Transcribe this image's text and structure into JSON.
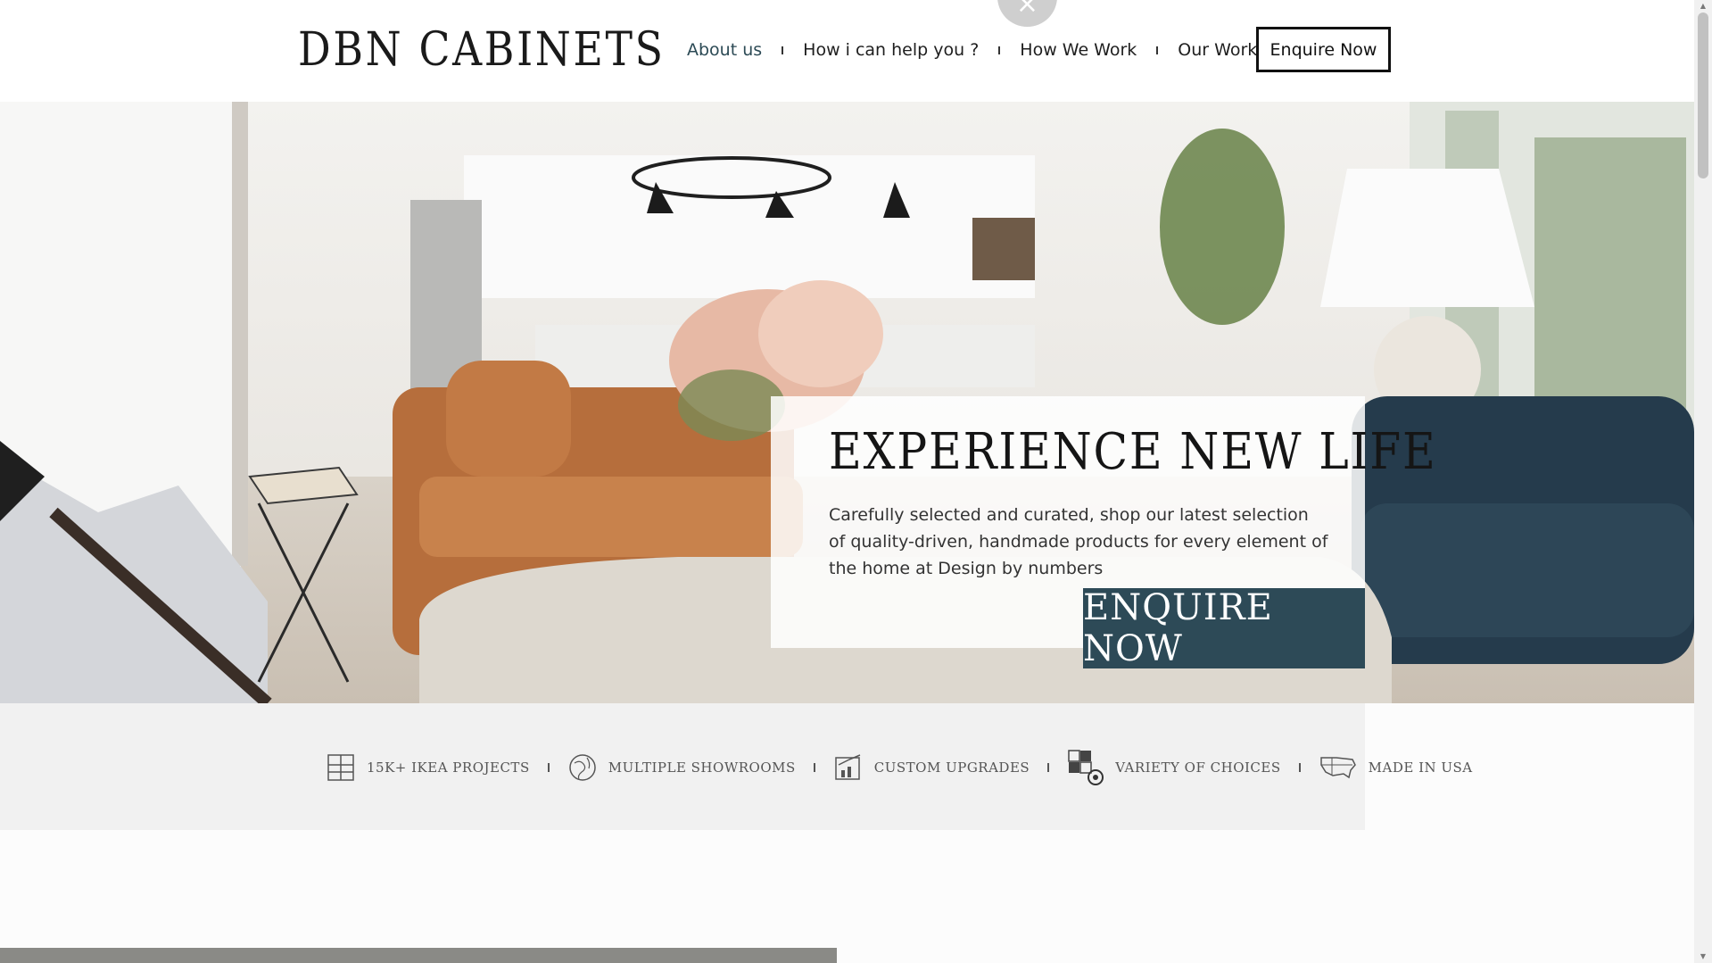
{
  "header": {
    "logo": "DBN CABINETS",
    "nav": [
      "About us",
      "How i can help you ?",
      "How We Work",
      "Our Work"
    ],
    "enquire_label": "Enquire Now",
    "close_symbol": "×"
  },
  "hero": {
    "title": "EXPERIENCE NEW LIFE",
    "text": "Carefully selected and curated, shop our latest selection of quality-driven, handmade products for every element of the home at Design by numbers",
    "button_label": "ENQUIRE NOW"
  },
  "features": [
    {
      "label": "15K+ IKEA PROJECTS",
      "icon": "cabinet-icon"
    },
    {
      "label": "MULTIPLE SHOWROOMS",
      "icon": "globe-icon"
    },
    {
      "label": "CUSTOM UPGRADES",
      "icon": "chart-upgrade-icon"
    },
    {
      "label": "VARIETY OF CHOICES",
      "icon": "pattern-gear-icon"
    },
    {
      "label": "MADE IN USA",
      "icon": "usa-map-icon"
    }
  ],
  "colors": {
    "accent": "#2d4a57",
    "nav_active": "#2c4a55"
  }
}
